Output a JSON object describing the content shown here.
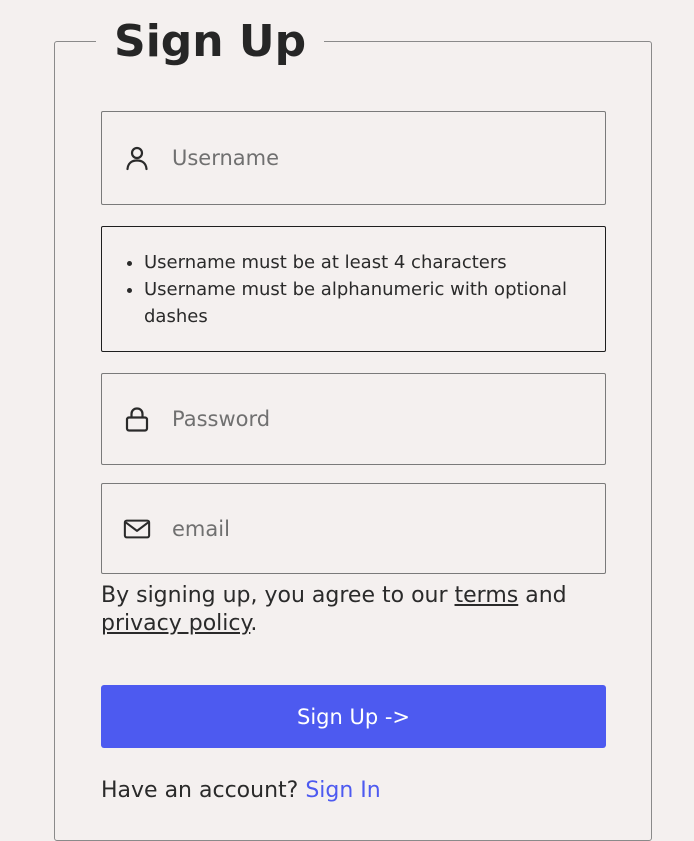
{
  "form": {
    "title": "Sign Up",
    "username": {
      "placeholder": "Username",
      "value": ""
    },
    "hints": [
      "Username must be at least 4 characters",
      "Username must be alphanumeric with optional dashes"
    ],
    "password": {
      "placeholder": "Password",
      "value": ""
    },
    "email": {
      "placeholder": "email",
      "value": ""
    },
    "agreement": {
      "prefix": "By signing up, you agree to our ",
      "terms_link": "terms",
      "middle": " and ",
      "privacy_link": "privacy policy",
      "suffix": "."
    },
    "submit_label": "Sign Up ->",
    "account_prompt": "Have an account? ",
    "signin_link": "Sign In"
  },
  "icons": {
    "username": "user-icon",
    "password": "lock-icon",
    "email": "mail-icon"
  },
  "colors": {
    "background": "#f4f0ef",
    "accent": "#4d5af0",
    "text": "#2a2a2a"
  }
}
